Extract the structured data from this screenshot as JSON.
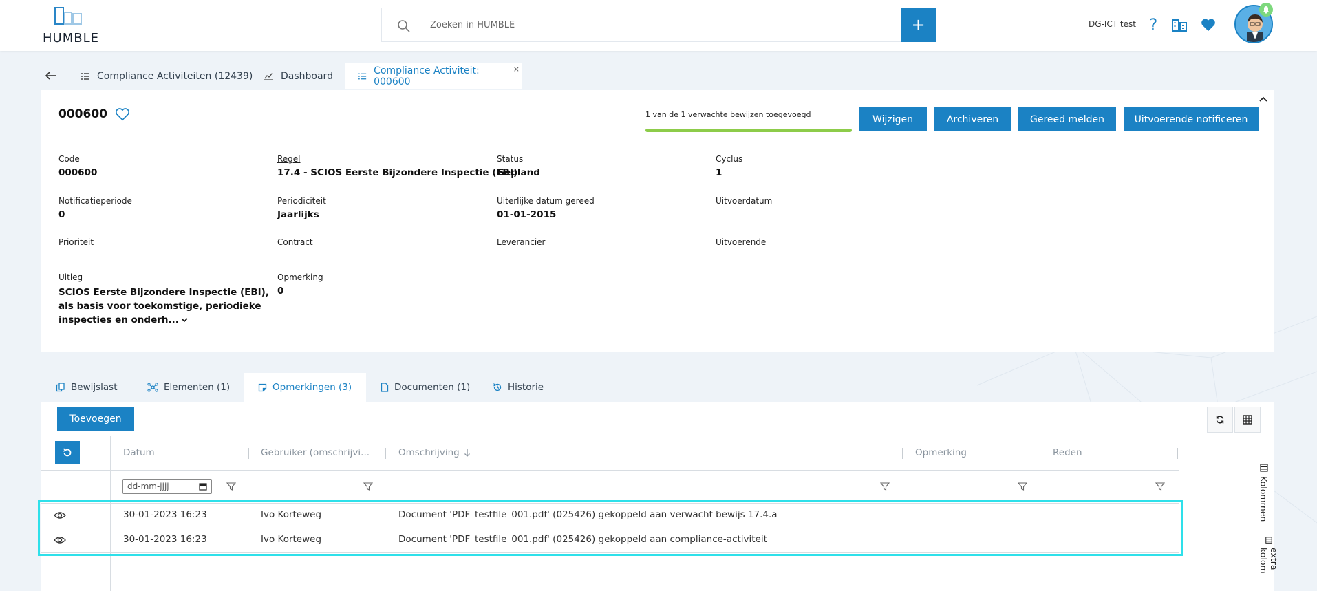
{
  "header": {
    "logo_text": "HUMBLE",
    "search_placeholder": "Zoeken in HUMBLE",
    "add_label": "+",
    "environment": "DG-ICT test",
    "help_label": "?"
  },
  "tabs": [
    {
      "label": "Compliance Activiteiten (12439)"
    },
    {
      "label": "Dashboard"
    },
    {
      "label": "Compliance Activiteit: 000600",
      "close": "×"
    }
  ],
  "record": {
    "id": "000600",
    "progress_text": "1 van de 1 verwachte bewijzen toegevoegd",
    "progress_fraction": 1.0,
    "actions": [
      "Wijzigen",
      "Archiveren",
      "Gereed melden",
      "Uitvoerende notificeren"
    ]
  },
  "fields": {
    "code": {
      "label": "Code",
      "value": "000600"
    },
    "regel": {
      "label": "Regel",
      "value": "17.4 - SCIOS Eerste Bijzondere Inspectie (EBI)"
    },
    "status": {
      "label": "Status",
      "value": "Gepland"
    },
    "cyclus": {
      "label": "Cyclus",
      "value": "1"
    },
    "notificatieperiode": {
      "label": "Notificatieperiode",
      "value": "0"
    },
    "periodiciteit": {
      "label": "Periodiciteit",
      "value": "Jaarlijks"
    },
    "uiterlijke_datum": {
      "label": "Uiterlijke datum gereed",
      "value": "01-01-2015"
    },
    "uitvoerdatum": {
      "label": "Uitvoerdatum",
      "value": ""
    },
    "prioriteit": {
      "label": "Prioriteit",
      "value": ""
    },
    "contract": {
      "label": "Contract",
      "value": ""
    },
    "leverancier": {
      "label": "Leverancier",
      "value": ""
    },
    "uitvoerende": {
      "label": "Uitvoerende",
      "value": ""
    },
    "uitleg": {
      "label": "Uitleg",
      "value": "SCIOS Eerste Bijzondere Inspectie (EBI), als basis voor toekomstige, periodieke inspecties en onderh..."
    },
    "opmerking": {
      "label": "Opmerking",
      "value": "0"
    }
  },
  "subtabs": [
    {
      "label": "Bewijslast"
    },
    {
      "label": "Elementen (1)"
    },
    {
      "label": "Opmerkingen (3)"
    },
    {
      "label": "Documenten (1)"
    },
    {
      "label": "Historie"
    }
  ],
  "grid": {
    "add_label": "Toevoegen",
    "columns": [
      "Datum",
      "Gebruiker (omschrijvi...",
      "Omschrijving",
      "Opmerking",
      "Reden"
    ],
    "date_placeholder": "dd-mm-jjjj",
    "rows": [
      {
        "datum": "30-01-2023 16:23",
        "gebruiker": "Ivo Korteweg",
        "omschrijving": "Document 'PDF_testfile_001.pdf' (025426) gekoppeld aan verwacht bewijs 17.4.a",
        "opmerking": "",
        "reden": ""
      },
      {
        "datum": "30-01-2023 16:23",
        "gebruiker": "Ivo Korteweg",
        "omschrijving": "Document 'PDF_testfile_001.pdf' (025426) gekoppeld aan compliance-activiteit",
        "opmerking": "",
        "reden": ""
      }
    ],
    "side": [
      "Kolommen",
      "extra kolom"
    ]
  },
  "colors": {
    "accent": "#1b82c4",
    "progress": "#8dcc4a",
    "highlight": "#2ee0ea"
  }
}
